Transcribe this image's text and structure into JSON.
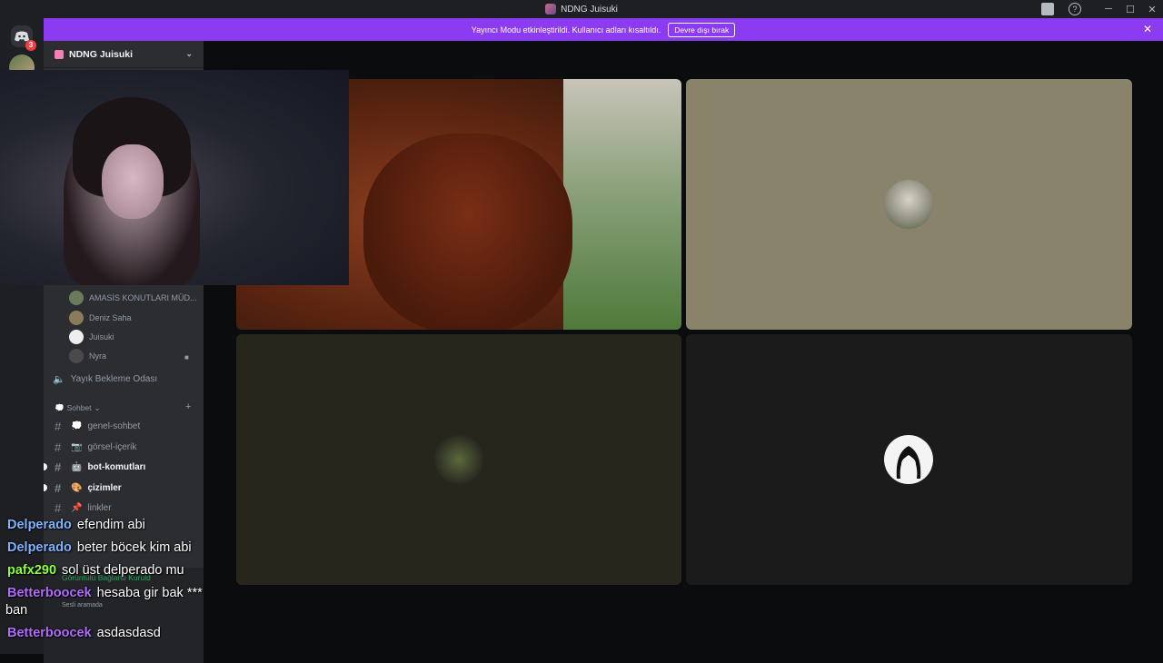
{
  "window": {
    "title": "NDNG Juisuki",
    "controls": [
      "─",
      "☐",
      "✕"
    ]
  },
  "guild_rail": {
    "notification_count": "3"
  },
  "banner": {
    "message": "Yayıncı Modu etkinleştirildi. Kullanıcı adları kısaltıldı.",
    "button_label": "Devre dışı bırak"
  },
  "sidebar": {
    "server_name": "NDNG Juisuki",
    "voice_users": [
      {
        "name": "AMASİS KONUTLARI MÜD..."
      },
      {
        "name": "Deniz Saha"
      },
      {
        "name": "Juisuki"
      },
      {
        "name": "Nyra"
      }
    ],
    "afk_channel": "Yayık Bekleme Odası",
    "category": "Sohbet",
    "channels": [
      {
        "name": "genel-sohbet",
        "emoji": "💭",
        "unread": false
      },
      {
        "name": "görsel-içerik",
        "emoji": "📷",
        "unread": false
      },
      {
        "name": "bot-komutları",
        "emoji": "🤖",
        "unread": true
      },
      {
        "name": "çizimler",
        "emoji": "🎨",
        "unread": true
      },
      {
        "name": "linkler",
        "emoji": "📌",
        "unread": false
      }
    ],
    "rtc_status": "Görüntülü Bağlantı Kuruld",
    "user_status": "Sesli aramada"
  },
  "chat": [
    {
      "user": "Delperado",
      "color": "#7fb2ff",
      "text": "efendim abi"
    },
    {
      "user": "Delperado",
      "color": "#7fb2ff",
      "text": "beter böcek kim abi"
    },
    {
      "user": "pafx290",
      "color": "#8aff3a",
      "text": "sol üst delperado mu"
    },
    {
      "user": "Betterboocek",
      "color": "#b26bff",
      "text": "hesaba gir bak ***"
    },
    {
      "user": "",
      "color": "#ffffff",
      "text": "ban"
    },
    {
      "user": "Betterboocek",
      "color": "#b26bff",
      "text": "asdasdasd"
    }
  ],
  "colors": {
    "accent": "#8c3cf0",
    "sidebar_bg": "#2b2d31",
    "tile_beige": "#88836a",
    "tile_dark": "#27261d",
    "tile_black": "#1b1b1b"
  }
}
